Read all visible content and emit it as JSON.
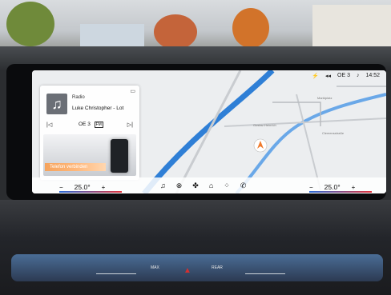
{
  "status_bar": {
    "station": "OE 3",
    "time": "14:52"
  },
  "media": {
    "source": "Radio",
    "track": "Luke Christopher - Lot",
    "station": "OE 3",
    "prev_icon": "skip-back-icon",
    "next_icon": "skip-forward-icon"
  },
  "phone_panel": {
    "cta": "Telefon verbinden"
  },
  "map": {
    "street_labels": [
      "Marktplatz",
      "Gustav-Heinrich",
      "Clemensstraße"
    ]
  },
  "climate": {
    "left": {
      "minus": "−",
      "temp": "25.0°",
      "plus": "+"
    },
    "right": {
      "minus": "−",
      "temp": "25.0°",
      "plus": "+"
    }
  },
  "nav_bar": {
    "icons": [
      "music-icon",
      "steering-wheel-icon",
      "fan-icon",
      "home-icon",
      "apps-icon",
      "phone-icon"
    ]
  },
  "control_strip": {
    "max_label": "MAX",
    "rear_label": "REAR"
  },
  "colors": {
    "accent_orange": "#f5a35c",
    "temp_blue": "#2b6bd6",
    "temp_red": "#e0343c",
    "map_route": "#2f7fd6"
  }
}
